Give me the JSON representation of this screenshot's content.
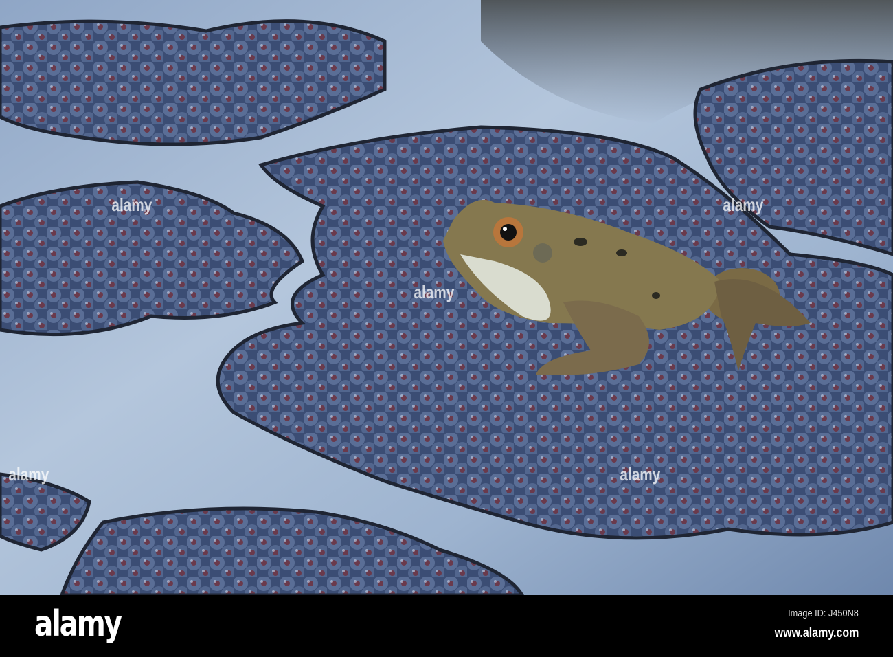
{
  "watermark": {
    "logo": "alamy",
    "image_id": "Image ID: J450N8",
    "website": "www.alamy.com",
    "overlay_text": "alamy"
  },
  "colors": {
    "water": "#a9bdd6",
    "spawn": "#3d4f73",
    "egg": "#6b3a4e",
    "frog": "#8a7d55"
  }
}
